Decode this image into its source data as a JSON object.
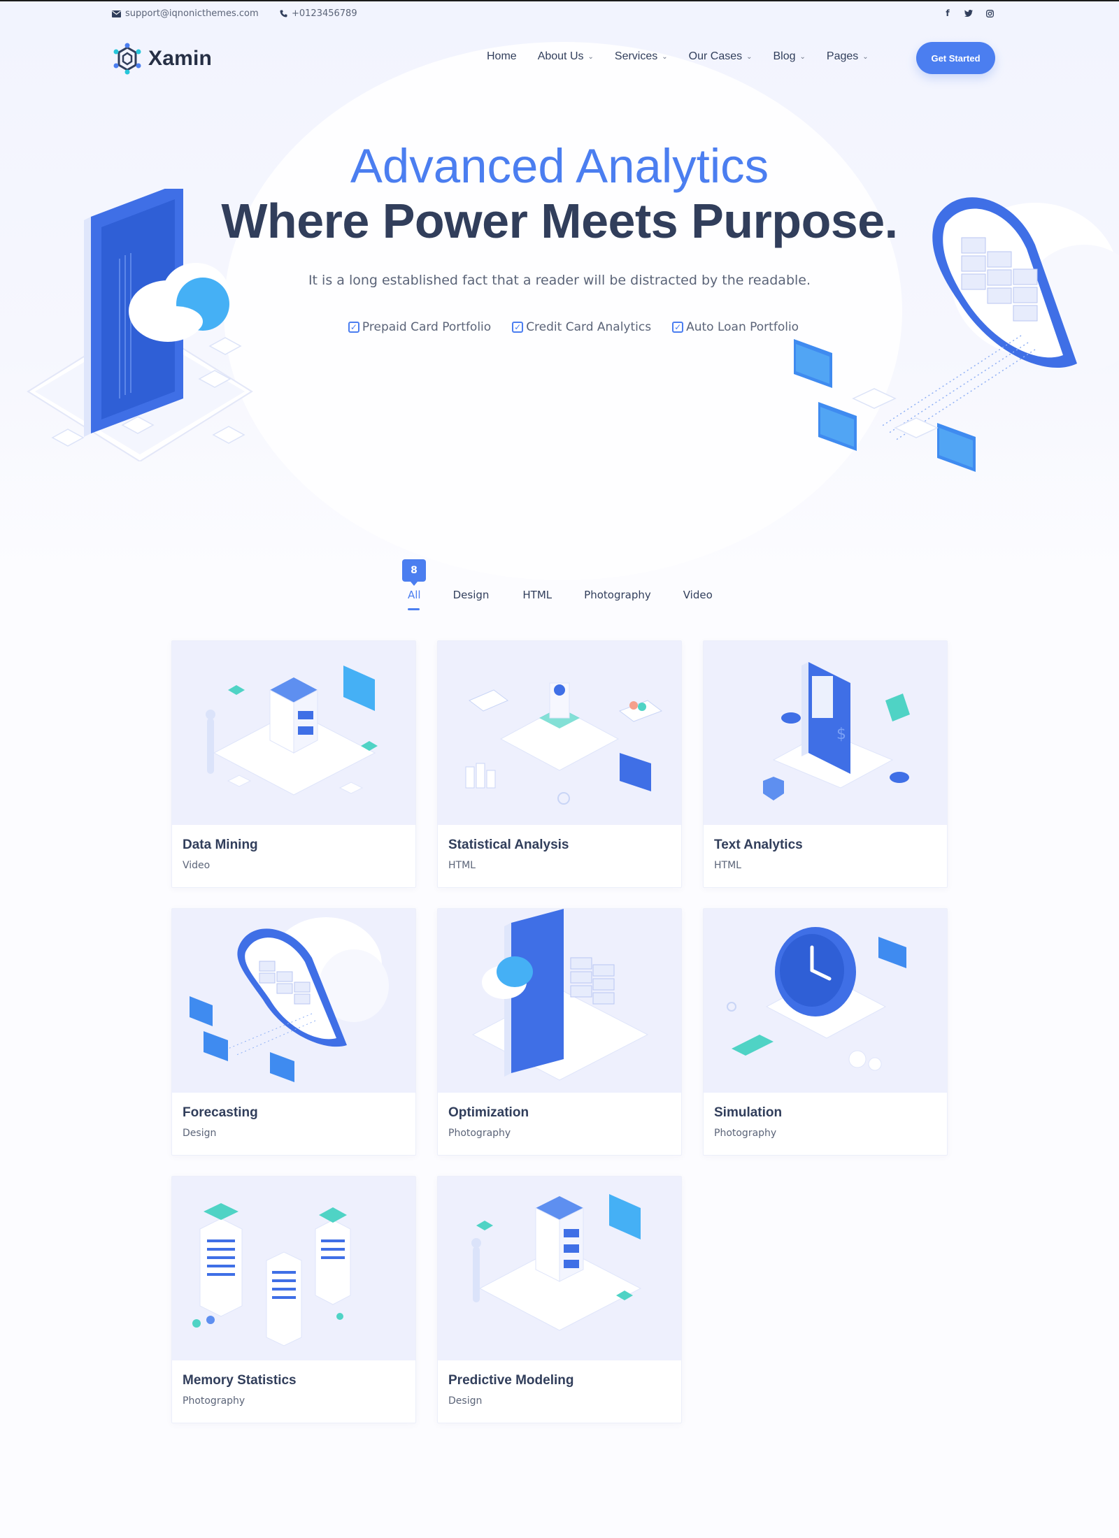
{
  "topbar": {
    "email": "support@iqnonicthemes.com",
    "phone": "+0123456789",
    "social_icons": [
      "facebook-icon",
      "twitter-icon",
      "instagram-icon"
    ]
  },
  "header": {
    "logo_text": "Xamin",
    "nav": [
      {
        "label": "Home",
        "dropdown": false
      },
      {
        "label": "About Us",
        "dropdown": true
      },
      {
        "label": "Services",
        "dropdown": true
      },
      {
        "label": "Our Cases",
        "dropdown": true
      },
      {
        "label": "Blog",
        "dropdown": true
      },
      {
        "label": "Pages",
        "dropdown": true
      }
    ],
    "cta_label": "Get Started"
  },
  "hero": {
    "title": "Advanced Analytics",
    "heading": "Where Power Meets Purpose.",
    "subtitle": "It is a long established fact that a reader will be distracted by the readable.",
    "features": [
      "Prepaid Card Portfolio",
      "Credit Card Analytics",
      "Auto Loan Portfolio"
    ]
  },
  "filters": {
    "count_badge": "8",
    "tabs": [
      "All",
      "Design",
      "HTML",
      "Photography",
      "Video"
    ],
    "active_tab": "All"
  },
  "portfolio": [
    {
      "title": "Data Mining",
      "category": "Video"
    },
    {
      "title": "Statistical Analysis",
      "category": "HTML"
    },
    {
      "title": "Text Analytics",
      "category": "HTML"
    },
    {
      "title": "Forecasting",
      "category": "Design"
    },
    {
      "title": "Optimization",
      "category": "Photography"
    },
    {
      "title": "Simulation",
      "category": "Photography"
    },
    {
      "title": "Memory Statistics",
      "category": "Photography"
    },
    {
      "title": "Predictive Modeling",
      "category": "Design"
    }
  ],
  "colors": {
    "accent": "#4b7ef0",
    "heading": "#313e5b",
    "text": "#5b6478",
    "thumb_bg": "#eef0fd"
  }
}
